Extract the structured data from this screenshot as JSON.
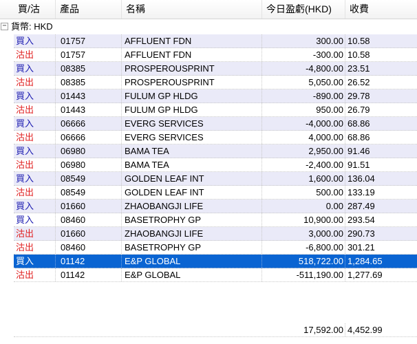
{
  "columns": {
    "side": "買/沽",
    "product": "產品",
    "name": "名稱",
    "pnl": "今日盈虧(HKD)",
    "fee": "收費"
  },
  "group": {
    "expander": "−",
    "label": "貨幣: HKD"
  },
  "rows": [
    {
      "side": "買入",
      "type": "buy",
      "code": "01757",
      "name": "AFFLUENT FDN",
      "pnl": "300.00",
      "fee": "10.58"
    },
    {
      "side": "沽出",
      "type": "sell",
      "code": "01757",
      "name": "AFFLUENT FDN",
      "pnl": "-300.00",
      "fee": "10.58"
    },
    {
      "side": "買入",
      "type": "buy",
      "code": "08385",
      "name": "PROSPEROUSPRINT",
      "pnl": "-4,800.00",
      "fee": "23.51"
    },
    {
      "side": "沽出",
      "type": "sell",
      "code": "08385",
      "name": "PROSPEROUSPRINT",
      "pnl": "5,050.00",
      "fee": "26.52"
    },
    {
      "side": "買入",
      "type": "buy",
      "code": "01443",
      "name": "FULUM GP HLDG",
      "pnl": "-890.00",
      "fee": "29.78"
    },
    {
      "side": "沽出",
      "type": "sell",
      "code": "01443",
      "name": "FULUM GP HLDG",
      "pnl": "950.00",
      "fee": "26.79"
    },
    {
      "side": "買入",
      "type": "buy",
      "code": "06666",
      "name": "EVERG SERVICES",
      "pnl": "-4,000.00",
      "fee": "68.86"
    },
    {
      "side": "沽出",
      "type": "sell",
      "code": "06666",
      "name": "EVERG SERVICES",
      "pnl": "4,000.00",
      "fee": "68.86"
    },
    {
      "side": "買入",
      "type": "buy",
      "code": "06980",
      "name": "BAMA TEA",
      "pnl": "2,950.00",
      "fee": "91.46"
    },
    {
      "side": "沽出",
      "type": "sell",
      "code": "06980",
      "name": "BAMA TEA",
      "pnl": "-2,400.00",
      "fee": "91.51"
    },
    {
      "side": "買入",
      "type": "buy",
      "code": "08549",
      "name": "GOLDEN LEAF INT",
      "pnl": "1,600.00",
      "fee": "136.04"
    },
    {
      "side": "沽出",
      "type": "sell",
      "code": "08549",
      "name": "GOLDEN LEAF INT",
      "pnl": "500.00",
      "fee": "133.19"
    },
    {
      "side": "買入",
      "type": "buy",
      "code": "01660",
      "name": "ZHAOBANGJI LIFE",
      "pnl": "0.00",
      "fee": "287.49"
    },
    {
      "side": "買入",
      "type": "buy",
      "code": "08460",
      "name": "BASETROPHY GP",
      "pnl": "10,900.00",
      "fee": "293.54"
    },
    {
      "side": "沽出",
      "type": "sell",
      "code": "01660",
      "name": "ZHAOBANGJI LIFE",
      "pnl": "3,000.00",
      "fee": "290.73"
    },
    {
      "side": "沽出",
      "type": "sell",
      "code": "08460",
      "name": "BASETROPHY GP",
      "pnl": "-6,800.00",
      "fee": "301.21"
    },
    {
      "side": "買入",
      "type": "buy",
      "code": "01142",
      "name": "E&P GLOBAL",
      "pnl": "518,722.00",
      "fee": "1,284.65",
      "selected": true
    },
    {
      "side": "沽出",
      "type": "sell",
      "code": "01142",
      "name": "E&P GLOBAL",
      "pnl": "-511,190.00",
      "fee": "1,277.69"
    }
  ],
  "totals": {
    "pnl": "17,592.00",
    "fee": "4,452.99"
  },
  "colors": {
    "buy": "#1a1ab0",
    "sell": "#e02020",
    "selected_row": "#0a64d2",
    "alt_row": "#eaeaf8"
  }
}
